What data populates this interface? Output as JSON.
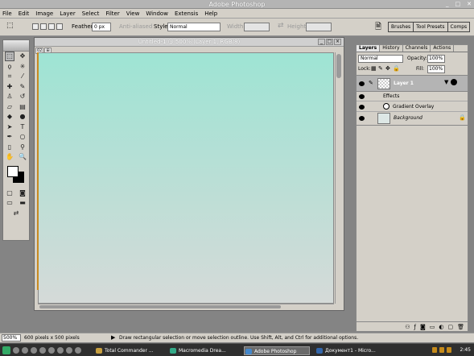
{
  "app_title": "Adobe Photoshop",
  "menu": [
    "File",
    "Edit",
    "Image",
    "Layer",
    "Select",
    "Filter",
    "View",
    "Window",
    "Extensis",
    "Help"
  ],
  "options": {
    "feather_label": "Feather:",
    "feather_value": "0 px",
    "anti_aliased": "Anti-aliased",
    "style_label": "Style:",
    "style_value": "Normal",
    "width_label": "Width:",
    "height_label": "Height:"
  },
  "palette_well": [
    "Brushes",
    "Tool Presets",
    "Comps"
  ],
  "document": {
    "title": "Untitled-1 @ 500% (Layer 1, RGB/8)",
    "zoom_field": "500%",
    "size_info": "600 pixels x 500 pixels"
  },
  "status_hint": "Draw rectangular selection or move selection outline.  Use Shift, Alt, and Ctrl for additional options.",
  "layers_panel": {
    "tabs": [
      "Layers",
      "History",
      "Channels",
      "Actions"
    ],
    "blend_mode": "Normal",
    "opacity_label": "Opacity:",
    "opacity_value": "100%",
    "lock_label": "Lock:",
    "fill_label": "Fill:",
    "fill_value": "100%",
    "layer1": "Layer 1",
    "effects": "Effects",
    "gradient_overlay": "Gradient Overlay",
    "background": "Background"
  },
  "taskbar": {
    "items": [
      "Total Commander ...",
      "Macromedia Drea...",
      "Adobe Photoshop",
      "Документ1 - Micro..."
    ],
    "clock": "2:45"
  },
  "colors": {
    "canvas_top": "#9ee4d4",
    "canvas_bottom": "#d5dad8",
    "layer_selected": "#b4b4b4",
    "taskbar": "#2f2f2f"
  }
}
